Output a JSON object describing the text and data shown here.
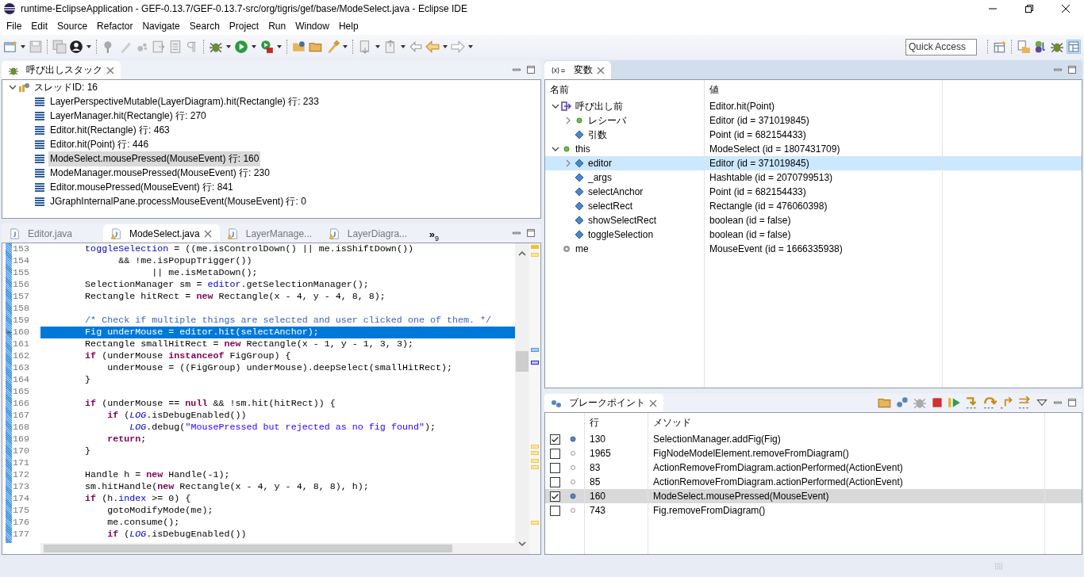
{
  "window": {
    "title": "runtime-EclipseApplication - GEF-0.13.7/GEF-0.13.7-src/org/tigris/gef/base/ModeSelect.java - Eclipse IDE"
  },
  "menu": [
    {
      "label": "File"
    },
    {
      "label": "Edit"
    },
    {
      "label": "Source"
    },
    {
      "label": "Refactor"
    },
    {
      "label": "Navigate"
    },
    {
      "label": "Search"
    },
    {
      "label": "Project"
    },
    {
      "label": "Run"
    },
    {
      "label": "Window"
    },
    {
      "label": "Help"
    }
  ],
  "quick_access": {
    "placeholder": "Quick Access"
  },
  "call_stack": {
    "title": "呼び出しスタック",
    "thread": {
      "label": "スレッドID: 16",
      "expanded": true,
      "frames": [
        {
          "label": "LayerPerspectiveMutable(LayerDiagram).hit(Rectangle) 行: 233",
          "selected": false
        },
        {
          "label": "LayerManager.hit(Rectangle) 行: 270",
          "selected": false
        },
        {
          "label": "Editor.hit(Rectangle) 行: 463",
          "selected": false
        },
        {
          "label": "Editor.hit(Point) 行: 446",
          "selected": false
        },
        {
          "label": "ModeSelect.mousePressed(MouseEvent) 行: 160",
          "selected": true
        },
        {
          "label": "ModeManager.mousePressed(MouseEvent) 行: 230",
          "selected": false
        },
        {
          "label": "Editor.mousePressed(MouseEvent) 行: 841",
          "selected": false
        },
        {
          "label": "JGraphInternalPane.processMouseEvent(MouseEvent) 行: 0",
          "selected": false
        }
      ]
    }
  },
  "editor": {
    "tabs": [
      {
        "label": "Editor.java",
        "selected": false,
        "warning": false
      },
      {
        "label": "ModeSelect.java",
        "selected": true,
        "warning": true
      },
      {
        "label": "LayerManage...",
        "selected": false,
        "warning": true
      },
      {
        "label": "LayerDiagra...",
        "selected": false,
        "warning": true
      }
    ],
    "overflow": "»",
    "overflow_count": "9",
    "lines": [
      {
        "number": "153",
        "current": false,
        "segments": [
          {
            "text": "        toggleSelection",
            "kind": "field"
          },
          {
            "text": " = ((me.isControlDown() || me.isShiftDown())"
          }
        ]
      },
      {
        "number": "154",
        "current": false,
        "segments": [
          {
            "text": "              && !me.isPopupTrigger())"
          }
        ]
      },
      {
        "number": "155",
        "current": false,
        "segments": [
          {
            "text": "                    || me.isMetaDown();"
          }
        ]
      },
      {
        "number": "156",
        "current": false,
        "segments": [
          {
            "text": "        SelectionManager sm = "
          },
          {
            "text": "editor",
            "kind": "field"
          },
          {
            "text": ".getSelectionManager();"
          }
        ]
      },
      {
        "number": "157",
        "current": false,
        "segments": [
          {
            "text": "        Rectangle hitRect = "
          },
          {
            "text": "new",
            "kind": "keyword"
          },
          {
            "text": " Rectangle(x - 4, y - 4, 8, 8);"
          }
        ]
      },
      {
        "number": "158",
        "current": false
      },
      {
        "number": "159",
        "current": false,
        "segments": [
          {
            "text": "        /* Check if multiple things are selected and user clicked one of them. */",
            "kind": "comment"
          }
        ]
      },
      {
        "number": "160",
        "current": true,
        "segments": [
          {
            "text": "        Fig underMouse = "
          },
          {
            "text": "editor",
            "kind": "field"
          },
          {
            "text": ".hit("
          },
          {
            "text": "selectAnchor",
            "kind": "field"
          },
          {
            "text": ");"
          }
        ]
      },
      {
        "number": "161",
        "current": false,
        "segments": [
          {
            "text": "        Rectangle smallHitRect = "
          },
          {
            "text": "new",
            "kind": "keyword"
          },
          {
            "text": " Rectangle(x - 1, y - 1, 3, 3);"
          }
        ]
      },
      {
        "number": "162",
        "current": false,
        "segments": [
          {
            "text": "        if",
            "kind": "keyword"
          },
          {
            "text": " (underMouse "
          },
          {
            "text": "instanceof",
            "kind": "keyword"
          },
          {
            "text": " FigGroup) {"
          }
        ]
      },
      {
        "number": "163",
        "current": false,
        "segments": [
          {
            "text": "            underMouse = ((FigGroup) underMouse).deepSelect(smallHitRect);"
          }
        ]
      },
      {
        "number": "164",
        "current": false,
        "segments": [
          {
            "text": "        }"
          }
        ]
      },
      {
        "number": "165",
        "current": false
      },
      {
        "number": "166",
        "current": false,
        "segments": [
          {
            "text": "        if",
            "kind": "keyword"
          },
          {
            "text": " (underMouse == "
          },
          {
            "text": "null",
            "kind": "keyword"
          },
          {
            "text": " && !sm.hit(hitRect)) {"
          }
        ]
      },
      {
        "number": "167",
        "current": false,
        "segments": [
          {
            "text": "            if",
            "kind": "keyword"
          },
          {
            "text": " ("
          },
          {
            "text": "LOG",
            "kind": "static"
          },
          {
            "text": ".isDebugEnabled())"
          }
        ]
      },
      {
        "number": "168",
        "current": false,
        "segments": [
          {
            "text": "                LOG",
            "kind": "static"
          },
          {
            "text": ".debug("
          },
          {
            "text": "\"MousePressed but rejected as no fig found\"",
            "kind": "string"
          },
          {
            "text": ");"
          }
        ]
      },
      {
        "number": "169",
        "current": false,
        "segments": [
          {
            "text": "            return",
            "kind": "keyword"
          },
          {
            "text": ";"
          }
        ]
      },
      {
        "number": "170",
        "current": false,
        "segments": [
          {
            "text": "        }"
          }
        ]
      },
      {
        "number": "171",
        "current": false
      },
      {
        "number": "172",
        "current": false,
        "segments": [
          {
            "text": "        Handle h = "
          },
          {
            "text": "new",
            "kind": "keyword"
          },
          {
            "text": " Handle(-1);"
          }
        ]
      },
      {
        "number": "173",
        "current": false,
        "segments": [
          {
            "text": "        sm.hitHandle("
          },
          {
            "text": "new",
            "kind": "keyword"
          },
          {
            "text": " Rectangle(x - 4, y - 4, 8, 8), h);"
          }
        ]
      },
      {
        "number": "174",
        "current": false,
        "segments": [
          {
            "text": "        if",
            "kind": "keyword"
          },
          {
            "text": " (h."
          },
          {
            "text": "index",
            "kind": "field"
          },
          {
            "text": " >= 0) {"
          }
        ]
      },
      {
        "number": "175",
        "current": false,
        "segments": [
          {
            "text": "            gotoModifyMode(me);"
          }
        ]
      },
      {
        "number": "176",
        "current": false,
        "segments": [
          {
            "text": "            me.consume();"
          }
        ]
      },
      {
        "number": "177",
        "current": false,
        "segments": [
          {
            "text": "            if",
            "kind": "keyword"
          },
          {
            "text": " ("
          },
          {
            "text": "LOG",
            "kind": "static"
          },
          {
            "text": ".isDebugEnabled())"
          }
        ]
      }
    ]
  },
  "variables": {
    "title": "変数",
    "columns": [
      "名前",
      "値"
    ],
    "rows": [
      {
        "name": "呼び出し前",
        "value": "Editor.hit(Point)",
        "kind": "entry",
        "expanded": true,
        "selected": false,
        "children": [
          {
            "name": "レシーバ",
            "value": "Editor (id = 371019845)",
            "kind": "object",
            "expanded": false,
            "selected": false
          },
          {
            "name": "引数",
            "value": "Point (id = 682154433)",
            "kind": "field",
            "selected": false
          }
        ]
      },
      {
        "name": "this",
        "value": "ModeSelect (id = 1807431709)",
        "kind": "object",
        "expanded": true,
        "selected": false,
        "children": [
          {
            "name": "editor",
            "value": "Editor (id = 371019845)",
            "kind": "field",
            "expanded": false,
            "selected": true
          },
          {
            "name": "_args",
            "value": "Hashtable (id = 2070799513)",
            "kind": "field",
            "selected": false
          },
          {
            "name": "selectAnchor",
            "value": "Point (id = 682154433)",
            "kind": "field",
            "selected": false
          },
          {
            "name": "selectRect",
            "value": "Rectangle (id = 476060398)",
            "kind": "field",
            "selected": false
          },
          {
            "name": "showSelectRect",
            "value": "boolean (id = false)",
            "kind": "field",
            "selected": false
          },
          {
            "name": "toggleSelection",
            "value": "boolean (id = false)",
            "kind": "field",
            "selected": false
          }
        ]
      },
      {
        "name": "me",
        "value": "MouseEvent (id = 1666335938)",
        "kind": "local",
        "selected": false
      }
    ]
  },
  "breakpoints": {
    "title": "ブレークポイント",
    "columns": [
      "行",
      "メソッド"
    ],
    "rows": [
      {
        "checked": true,
        "line": "130",
        "method": "SelectionManager.addFig(Fig)",
        "selected": false
      },
      {
        "checked": false,
        "line": "1965",
        "method": "FigNodeModelElement.removeFromDiagram()",
        "selected": false
      },
      {
        "checked": false,
        "line": "83",
        "method": "ActionRemoveFromDiagram.actionPerformed(ActionEvent)",
        "selected": false
      },
      {
        "checked": false,
        "line": "85",
        "method": "ActionRemoveFromDiagram.actionPerformed(ActionEvent)",
        "selected": false
      },
      {
        "checked": true,
        "line": "160",
        "method": "ModeSelect.mousePressed(MouseEvent)",
        "selected": true
      },
      {
        "checked": false,
        "line": "743",
        "method": "Fig.removeFromDiagram()",
        "selected": false
      }
    ]
  }
}
